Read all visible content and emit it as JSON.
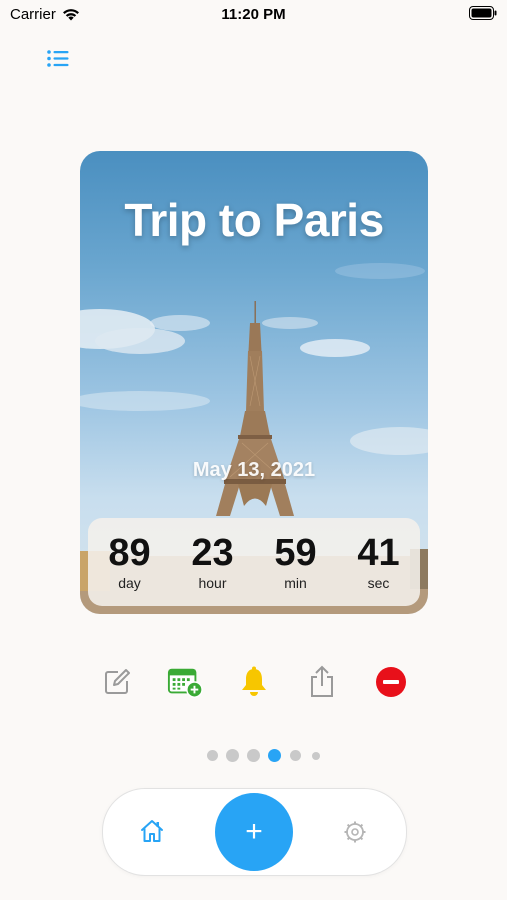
{
  "status_bar": {
    "carrier": "Carrier",
    "time": "11:20 PM"
  },
  "card": {
    "title": "Trip to Paris",
    "date": "May 13, 2021",
    "countdown": [
      {
        "value": "89",
        "label": "day"
      },
      {
        "value": "23",
        "label": "hour"
      },
      {
        "value": "59",
        "label": "min"
      },
      {
        "value": "41",
        "label": "sec"
      }
    ]
  },
  "actions": [
    {
      "name": "edit",
      "icon": "edit-icon"
    },
    {
      "name": "add-to-calendar",
      "icon": "calendar-add-icon"
    },
    {
      "name": "reminder",
      "icon": "bell-icon"
    },
    {
      "name": "share",
      "icon": "share-icon"
    },
    {
      "name": "delete",
      "icon": "minus-circle-icon"
    }
  ],
  "pager": {
    "count": 6,
    "active_index": 3
  },
  "tabbar": {
    "home_icon": "home-icon",
    "add_label": "+",
    "settings_icon": "gear-icon"
  },
  "colors": {
    "accent": "#28a4f5",
    "bell": "#f7c600",
    "calendar": "#3aaa35",
    "delete": "#e8101a",
    "background": "#fbf9f7"
  }
}
